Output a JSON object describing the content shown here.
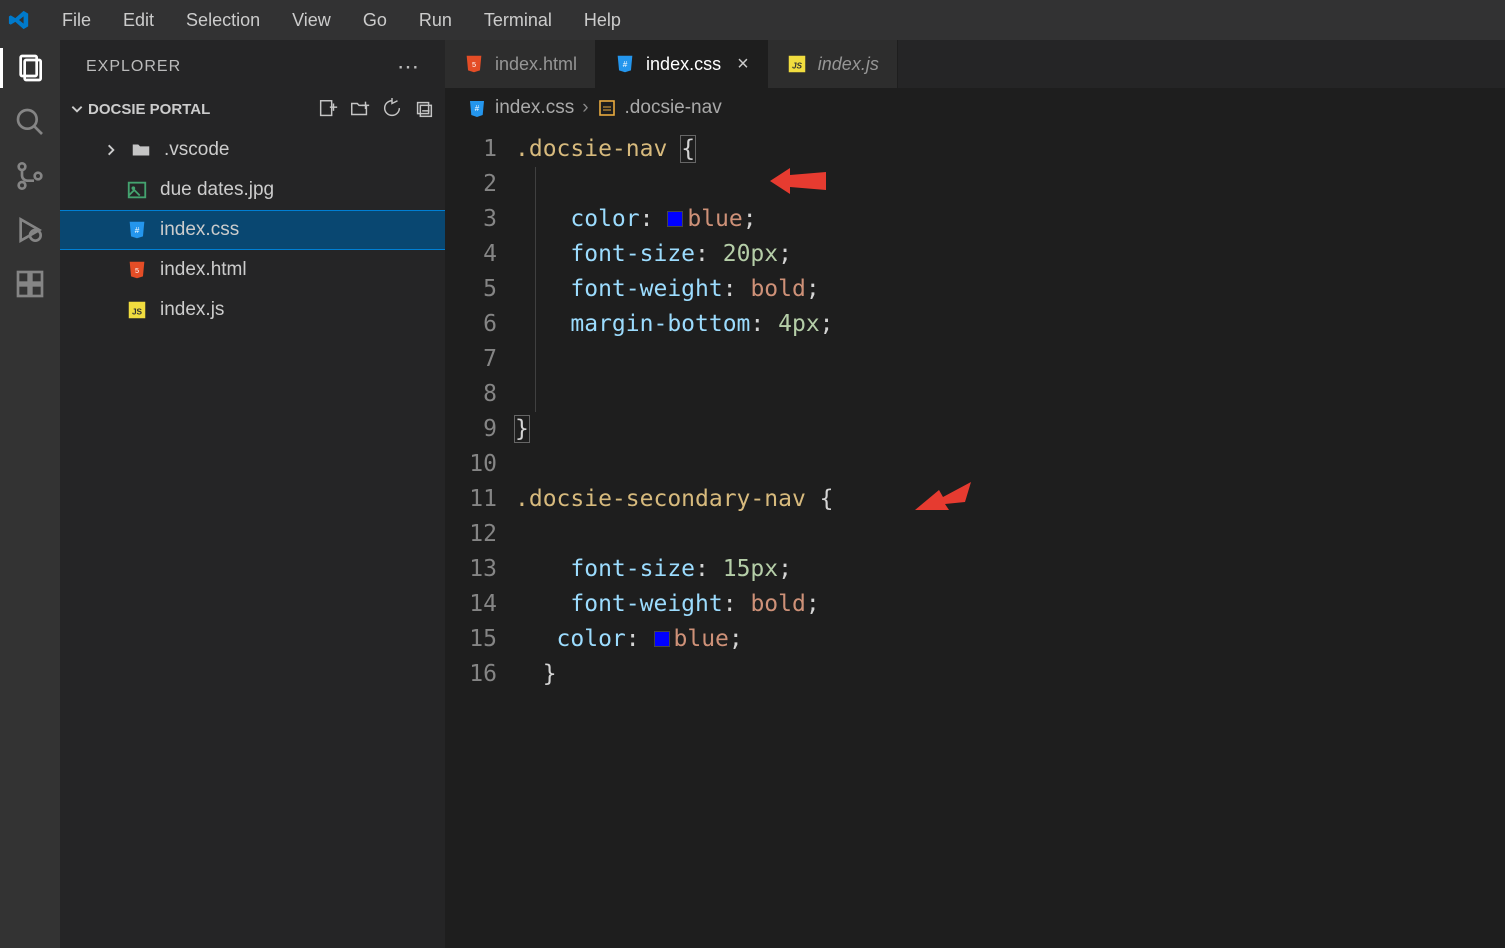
{
  "menubar": [
    "File",
    "Edit",
    "Selection",
    "View",
    "Go",
    "Run",
    "Terminal",
    "Help"
  ],
  "sidebar": {
    "title": "EXPLORER",
    "folder": "DOCSIE PORTAL",
    "items": [
      {
        "name": ".vscode",
        "type": "folder"
      },
      {
        "name": "due dates.jpg",
        "type": "image"
      },
      {
        "name": "index.css",
        "type": "css",
        "selected": true
      },
      {
        "name": "index.html",
        "type": "html"
      },
      {
        "name": "index.js",
        "type": "js"
      }
    ]
  },
  "tabs": [
    {
      "name": "index.html",
      "type": "html",
      "active": false,
      "italic": false
    },
    {
      "name": "index.css",
      "type": "css",
      "active": true,
      "italic": false,
      "close": true
    },
    {
      "name": "index.js",
      "type": "js",
      "active": false,
      "italic": true
    }
  ],
  "breadcrumbs": {
    "file": "index.css",
    "symbol": ".docsie-nav"
  },
  "code": {
    "lines": [
      {
        "n": 1,
        "html": "<span class='sel'>.docsie-nav</span> <span class='brace'>{</span>"
      },
      {
        "n": 2,
        "html": ""
      },
      {
        "n": 3,
        "html": "    <span class='prop'>color</span><span class='punct'>:</span> <span class='color-swatch'></span><span class='val'>blue</span><span class='punct'>;</span>"
      },
      {
        "n": 4,
        "html": "    <span class='prop'>font-size</span><span class='punct'>:</span> <span class='num'>20px</span><span class='punct'>;</span>"
      },
      {
        "n": 5,
        "html": "    <span class='prop'>font-weight</span><span class='punct'>:</span> <span class='val'>bold</span><span class='punct'>;</span>"
      },
      {
        "n": 6,
        "html": "    <span class='prop'>margin-bottom</span><span class='punct'>:</span> <span class='num'>4px</span><span class='punct'>;</span>"
      },
      {
        "n": 7,
        "html": ""
      },
      {
        "n": 8,
        "html": ""
      },
      {
        "n": 9,
        "html": "<span class='brace'>}</span>"
      },
      {
        "n": 10,
        "html": ""
      },
      {
        "n": 11,
        "html": "<span class='sel'>.docsie-secondary-nav</span> <span class='punct'>{</span>"
      },
      {
        "n": 12,
        "html": ""
      },
      {
        "n": 13,
        "html": "    <span class='prop'>font-size</span><span class='punct'>:</span> <span class='num'>15px</span><span class='punct'>;</span>"
      },
      {
        "n": 14,
        "html": "    <span class='prop'>font-weight</span><span class='punct'>:</span> <span class='val'>bold</span><span class='punct'>;</span>"
      },
      {
        "n": 15,
        "html": "   <span class='prop'>color</span><span class='punct'>:</span> <span class='color-swatch'></span><span class='val'>blue</span><span class='punct'>;</span>"
      },
      {
        "n": 16,
        "html": "  <span class='punct'>}</span>"
      }
    ]
  }
}
